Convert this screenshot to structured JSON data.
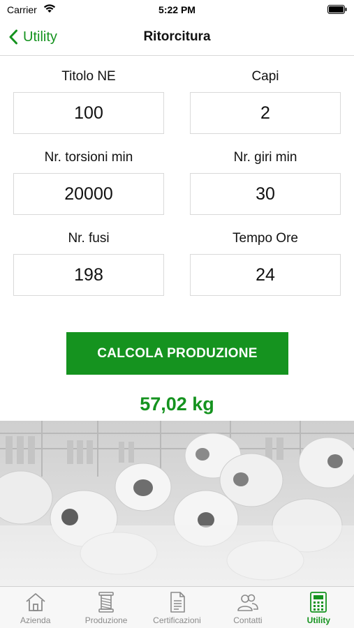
{
  "status_bar": {
    "carrier": "Carrier",
    "time": "5:22 PM"
  },
  "nav": {
    "back_label": "Utility",
    "title": "Ritorcitura"
  },
  "form": {
    "fields": [
      {
        "label": "Titolo NE",
        "value": "100"
      },
      {
        "label": "Capi",
        "value": "2"
      },
      {
        "label": "Nr. torsioni min",
        "value": "20000"
      },
      {
        "label": "Nr. giri min",
        "value": "30"
      },
      {
        "label": "Nr. fusi",
        "value": "198"
      },
      {
        "label": "Tempo Ore",
        "value": "24"
      }
    ],
    "button_label": "CALCOLA PRODUZIONE",
    "result": "57,02 kg"
  },
  "tabs": [
    {
      "label": "Azienda",
      "icon": "home-icon",
      "active": false
    },
    {
      "label": "Produzione",
      "icon": "spool-icon",
      "active": false
    },
    {
      "label": "Certificazioni",
      "icon": "document-icon",
      "active": false
    },
    {
      "label": "Contatti",
      "icon": "people-icon",
      "active": false
    },
    {
      "label": "Utility",
      "icon": "calculator-icon",
      "active": true
    }
  ],
  "colors": {
    "accent": "#15931f",
    "tab_inactive": "#8a8a8a"
  }
}
